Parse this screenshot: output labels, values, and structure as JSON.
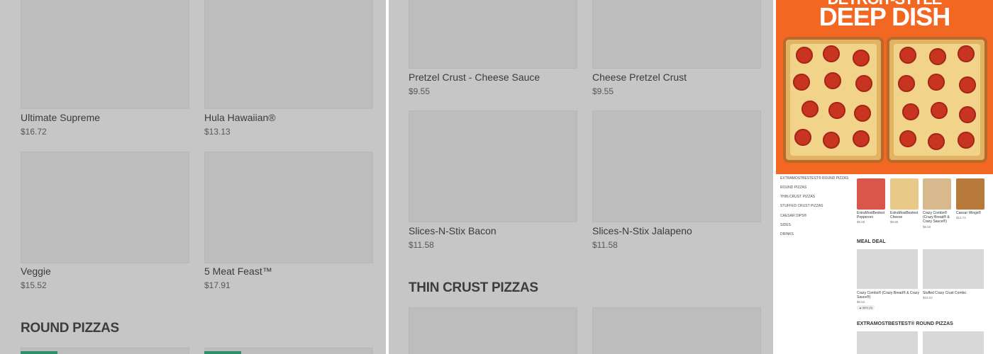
{
  "panel1": {
    "items": [
      {
        "name": "Ultimate Supreme",
        "price": "$16.72"
      },
      {
        "name": "Hula Hawaiian®",
        "price": "$13.13"
      },
      {
        "name": "Veggie",
        "price": "$15.52"
      },
      {
        "name": "5 Meat Feast™",
        "price": "$17.91"
      }
    ],
    "section_heading": "ROUND PIZZAS"
  },
  "panel2": {
    "items": [
      {
        "name": "Pretzel Crust - Cheese Sauce",
        "price": "$9.55"
      },
      {
        "name": "Cheese Pretzel Crust",
        "price": "$9.55"
      },
      {
        "name": "Slices-N-Stix Bacon",
        "price": "$11.58"
      },
      {
        "name": "Slices-N-Stix Jalapeno",
        "price": "$11.58"
      }
    ],
    "section_heading": "THIN CRUST PIZZAS"
  },
  "panel3": {
    "promo": {
      "line1": "DETROIT-STYLE",
      "line2": "DEEP DISH"
    },
    "sidebar": [
      "EXTRAMOSTBESTEST® ROUND PIZZAS",
      "ROUND PIZZAS",
      "THIN CRUST PIZZAS",
      "STUFFED CRUST PIZZAS",
      "CAESAR DIPS®",
      "SIDES",
      "DRINKS"
    ],
    "thumbs": [
      {
        "name": "ExtraMostBestest Pepperoni",
        "price": "$9.55"
      },
      {
        "name": "ExtraMostBestest Cheese",
        "price": "$9.55"
      },
      {
        "name": "Crazy Combo® (Crazy Bread® & Crazy Sauce®)",
        "price": "$6.52"
      },
      {
        "name": "Caesar Wings®",
        "price": "$12.74"
      }
    ],
    "meal_deal_heading": "MEAL DEAL",
    "meal_items": [
      {
        "name": "Crazy Combo® (Crazy Bread® & Crazy Sauce®)",
        "price": "$6.52",
        "badge": "▲ 86% (9)"
      },
      {
        "name": "Stuffed Crazy Crust Combo",
        "price": "$15.02"
      }
    ],
    "round_heading": "EXTRAMOSTBESTEST® ROUND PIZZAS"
  }
}
